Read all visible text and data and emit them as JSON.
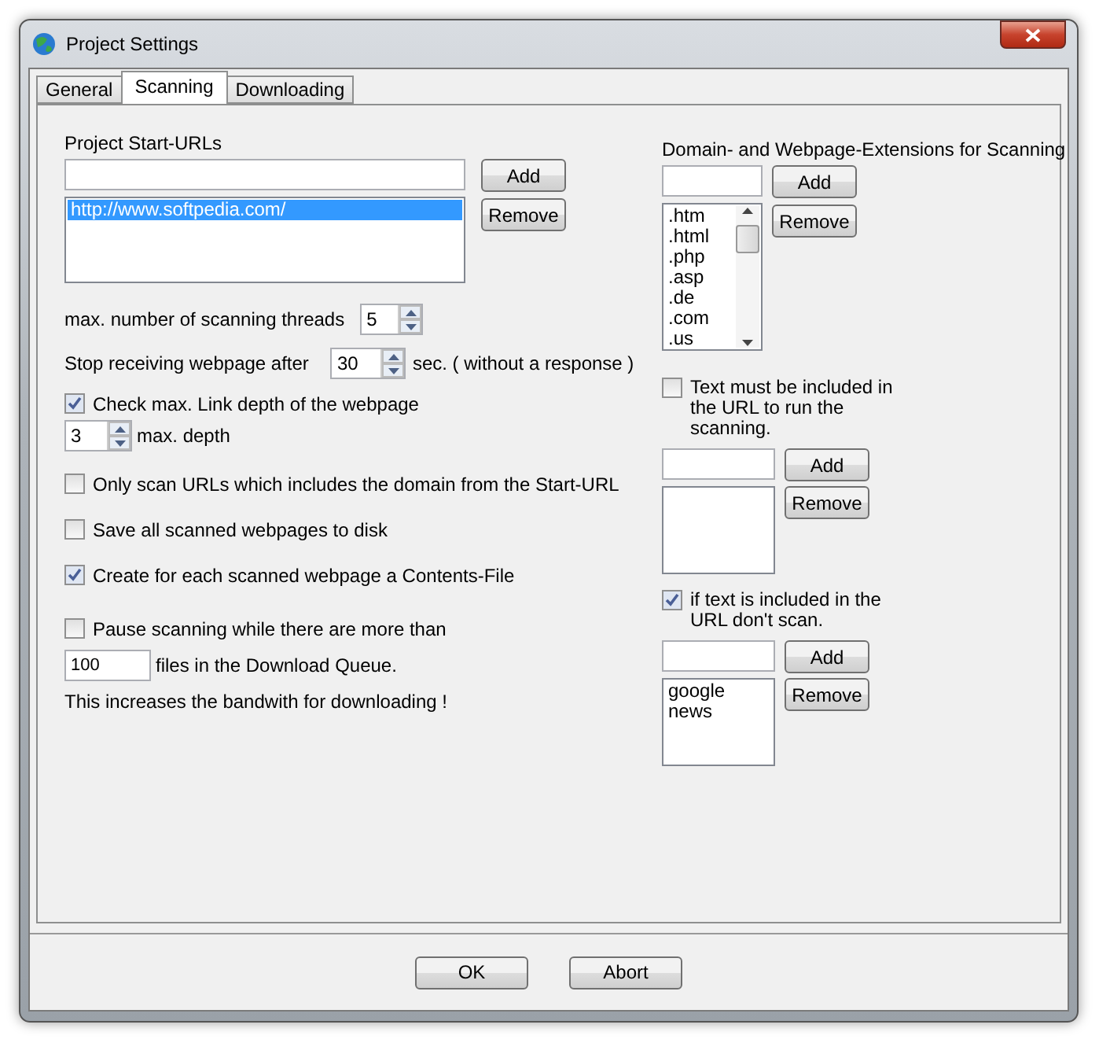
{
  "window": {
    "title": "Project Settings"
  },
  "tabs": [
    {
      "label": "General",
      "selected": false
    },
    {
      "label": "Scanning",
      "selected": true
    },
    {
      "label": "Downloading",
      "selected": false
    }
  ],
  "start_urls": {
    "label": "Project Start-URLs",
    "add": "Add",
    "remove": "Remove",
    "items": [
      {
        "text": "http://www.softpedia.com/",
        "selected": true
      }
    ]
  },
  "threads": {
    "label": "max. number of scanning threads",
    "value": "5"
  },
  "timeout": {
    "label": "Stop receiving webpage after",
    "value": "30",
    "suffix": "sec. ( without a response )"
  },
  "link_depth": {
    "label": "Check max. Link depth of the webpage",
    "checked": true,
    "value": "3",
    "suffix": "max. depth"
  },
  "options": [
    {
      "label": "Only scan URLs which includes the domain from the Start-URL",
      "checked": false
    },
    {
      "label": "Save all scanned webpages to disk",
      "checked": false
    },
    {
      "label": "Create for each scanned webpage a Contents-File",
      "checked": true
    }
  ],
  "pause": {
    "label": "Pause scanning while there are more than",
    "checked": false,
    "value": "100",
    "suffix": "files in the Download Queue.",
    "note": "This increases the bandwith for downloading !"
  },
  "extensions": {
    "label": "Domain- and Webpage-Extensions for Scanning",
    "add": "Add",
    "remove": "Remove",
    "items": [
      ".htm",
      ".html",
      ".php",
      ".asp",
      ".de",
      ".com",
      ".us"
    ]
  },
  "include": {
    "label": "Text must be included in the URL to run the scanning.",
    "checked": false,
    "add": "Add",
    "remove": "Remove"
  },
  "exclude": {
    "label": "if text is included in the URL don't scan.",
    "checked": true,
    "add": "Add",
    "remove": "Remove",
    "items": [
      "google",
      "news"
    ]
  },
  "buttons": [
    "OK",
    "Abort"
  ]
}
